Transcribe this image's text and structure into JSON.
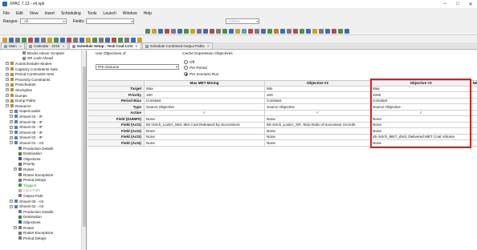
{
  "window": {
    "title": "XPAC 7.13 - v4.xpk",
    "min": "–",
    "max": "□",
    "close": "✕"
  },
  "menu": [
    "File",
    "Edit",
    "View",
    "Insert",
    "Scheduling",
    "Tools",
    "Launch",
    "Window",
    "Help"
  ],
  "toolbar": {
    "ranges_label": "Ranges:",
    "ranges_value": "- All -",
    "fields_label": "Fields:",
    "fields_value": "",
    "center_value": "<View>",
    "dropdown_arrow": "▾"
  },
  "tabs": [
    {
      "label": "Main",
      "active": false
    },
    {
      "label": "Calendar - 2019",
      "active": false
    },
    {
      "label": "Schedule Setup - Teck Coal LCO",
      "active": true
    },
    {
      "label": "Schedule Combined Output Paths",
      "active": false
    }
  ],
  "tree": [
    {
      "label": "Blocks Above Scripted",
      "indent": 4,
      "exp": "",
      "icon": "#8a8a8a"
    },
    {
      "label": "SR Look Ahead",
      "indent": 4,
      "exp": "",
      "icon": "#8a8a8a"
    },
    {
      "label": "AutoScheduler Modes",
      "indent": 1,
      "exp": "+",
      "icon": "#b8894a"
    },
    {
      "label": "Capacity Constraints Sets",
      "indent": 1,
      "exp": "+",
      "icon": "#b8894a"
    },
    {
      "label": "Period Constraints Sets",
      "indent": 1,
      "exp": "+",
      "icon": "#b8894a"
    },
    {
      "label": "Proximity Constraints",
      "indent": 1,
      "exp": "+",
      "icon": "#b8894a"
    },
    {
      "label": "Preschedule",
      "indent": 1,
      "exp": "+",
      "icon": "#b8894a"
    },
    {
      "label": "Stockpiles",
      "indent": 1,
      "exp": "+",
      "icon": "#b8894a"
    },
    {
      "label": "Dumps",
      "indent": 1,
      "exp": "+",
      "icon": "#b8894a"
    },
    {
      "label": "Dump Paths",
      "indent": 1,
      "exp": "+",
      "icon": "#b8894a"
    },
    {
      "label": "Resource",
      "indent": 1,
      "exp": "−",
      "icon": "#b8894a"
    },
    {
      "label": "SuperLoader",
      "indent": 2,
      "exp": "+",
      "icon": "#5a7fb5"
    },
    {
      "label": "Shovel 04 - IP",
      "indent": 2,
      "exp": "+",
      "icon": "#5a7fb5"
    },
    {
      "label": "Shovel 05 - IP",
      "indent": 2,
      "exp": "+",
      "icon": "#5a7fb5"
    },
    {
      "label": "Shovel 02 - IP",
      "indent": 2,
      "exp": "+",
      "icon": "#5a7fb5"
    },
    {
      "label": "Shovel 06 - IP",
      "indent": 2,
      "exp": "+",
      "icon": "#5a7fb5"
    },
    {
      "label": "Shovel 02 - IP",
      "indent": 2,
      "exp": "+",
      "icon": "#5a7fb5"
    },
    {
      "label": "Shovel 01 - AS",
      "indent": 2,
      "exp": "−",
      "icon": "#5a7fb5"
    },
    {
      "label": "Production Details",
      "indent": 3,
      "exp": "",
      "icon": "#7a7a7a"
    },
    {
      "label": "Destination",
      "indent": 3,
      "exp": "",
      "icon": "#3d8a3d"
    },
    {
      "label": "Objectives",
      "indent": 3,
      "exp": "",
      "icon": "#2a5fa0"
    },
    {
      "label": "Priority",
      "indent": 3,
      "exp": "",
      "icon": "#6a6a6a"
    },
    {
      "label": "Roster",
      "indent": 3,
      "exp": "+",
      "icon": "#7a7a7a"
    },
    {
      "label": "Roster Exceptions",
      "indent": 3,
      "exp": "",
      "icon": "#7a7a7a"
    },
    {
      "label": "Period Delays",
      "indent": 3,
      "exp": "",
      "icon": "#7a7a7a"
    },
    {
      "label": "Triggers",
      "indent": 3,
      "exp": "",
      "icon": "#3da03d",
      "color": "#2a9a2a"
    },
    {
      "label": "Input Path",
      "indent": 3,
      "exp": "",
      "icon": "#b0b0b0",
      "color": "#9a9a9a"
    },
    {
      "label": "Output Path",
      "indent": 3,
      "exp": "",
      "icon": "#7a7a7a"
    },
    {
      "label": "Shovel 06 - AS",
      "indent": 2,
      "exp": "+",
      "icon": "#5a7fb5"
    },
    {
      "label": "Shovel 02 - AS",
      "indent": 2,
      "exp": "−",
      "icon": "#5a7fb5"
    },
    {
      "label": "Production Details",
      "indent": 3,
      "exp": "",
      "icon": "#7a7a7a"
    },
    {
      "label": "Destination",
      "indent": 3,
      "exp": "",
      "icon": "#3d8a3d"
    },
    {
      "label": "Objectives",
      "indent": 3,
      "exp": "",
      "icon": "#2a5fa0"
    },
    {
      "label": "Roster",
      "indent": 3,
      "exp": "+",
      "icon": "#7a7a7a"
    },
    {
      "label": "Roster Exceptions",
      "indent": 3,
      "exp": "",
      "icon": "#7a7a7a"
    },
    {
      "label": "Period Delays",
      "indent": 3,
      "exp": "",
      "icon": "#7a7a7a"
    }
  ],
  "options": {
    "use_label": "Use Objectives of",
    "use_value": "Pre resource",
    "cache_title": "Cache Expression Objectives",
    "radios": [
      {
        "label": "Off",
        "checked": false
      },
      {
        "label": "Per Period",
        "checked": false
      },
      {
        "label": "Per Scenario Run",
        "checked": true
      }
    ]
  },
  "grid": {
    "columns": [
      "",
      "Max MET Mining",
      "Objective #2",
      "Objective #3",
      "Ne"
    ],
    "rows": [
      {
        "label": "Target",
        "cells": [
          "Max",
          "Min",
          "Max",
          ""
        ]
      },
      {
        "label": "Priority",
        "cells": [
          "100",
          "100",
          "1000",
          ""
        ]
      },
      {
        "label": "Period Bias",
        "cells": [
          "Constant",
          "Constant",
          "Constant",
          ""
        ]
      },
      {
        "label": "Type",
        "cells": [
          "Source Objective",
          "Source Objective",
          "Source Objective",
          ""
        ]
      },
      {
        "label": "Active",
        "cells": [
          "✓",
          "✓",
          "✓",
          ""
        ]
      },
      {
        "label": "Field (DUMP0)",
        "cells": [
          "None",
          "None",
          "None",
          ""
        ]
      },
      {
        "label": "Field (Act1)",
        "cells": [
          "60 mSch_LookA_Met, Met Coal Released by Successors",
          "59 mSch_LookA_SR, Strip Ratio of successor records",
          "None",
          ""
        ]
      },
      {
        "label": "Field (Act2)",
        "cells": [
          "None",
          "None",
          "None",
          ""
        ]
      },
      {
        "label": "Field (Act3)",
        "cells": [
          "None",
          "None",
          "45 mSch_MET_dVol, Delivered MET Coal Volume",
          ""
        ]
      },
      {
        "label": "Field (Act4)",
        "cells": [
          "None",
          "None",
          "None",
          ""
        ]
      }
    ]
  },
  "colors": {
    "highlight": "#d9201f"
  }
}
